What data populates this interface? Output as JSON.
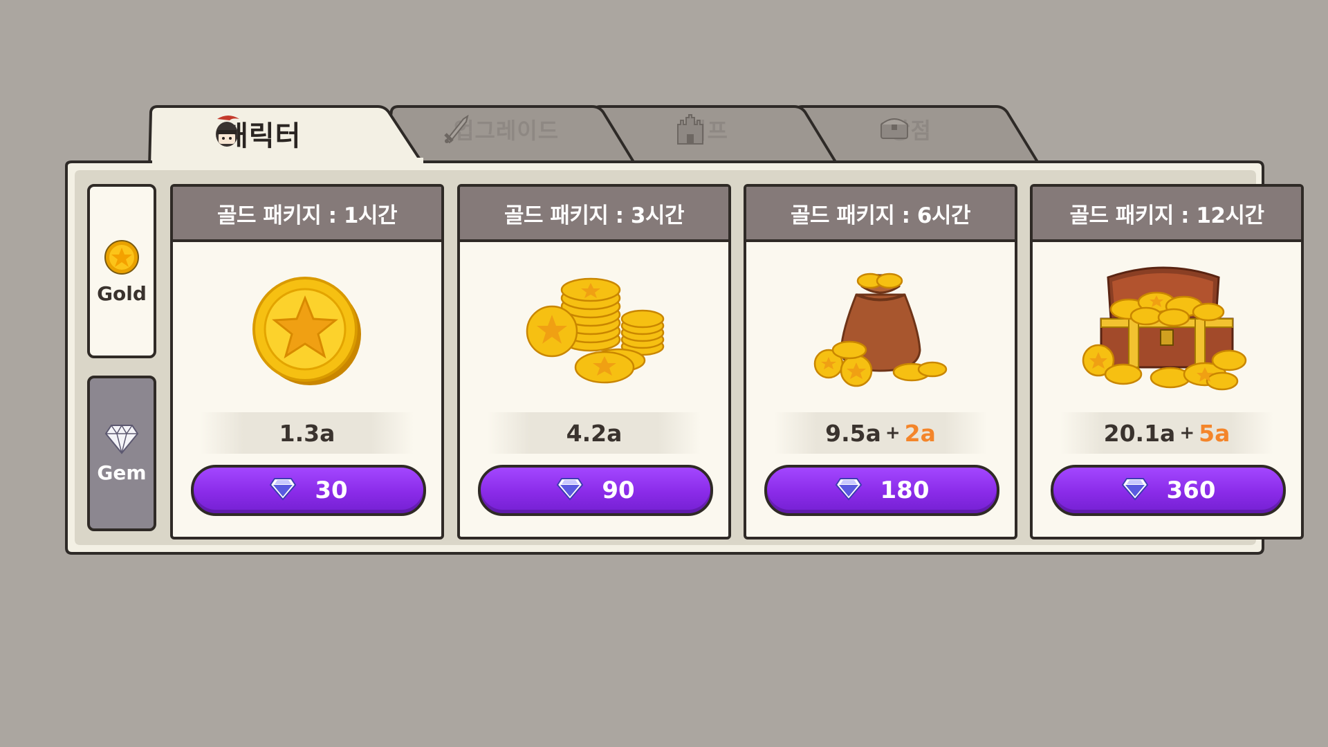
{
  "tabs": [
    {
      "label": "캐릭터",
      "icon": "knight-helmet-icon",
      "active": true
    },
    {
      "label": "업그레이드",
      "icon": "sword-icon",
      "active": false
    },
    {
      "label": "버프",
      "icon": "castle-icon",
      "active": false
    },
    {
      "label": "상점",
      "icon": "chest-icon",
      "active": false
    }
  ],
  "side": {
    "gold": {
      "label": "Gold",
      "icon": "gold-coin-icon",
      "selected": true
    },
    "gem": {
      "label": "Gem",
      "icon": "diamond-icon",
      "selected": false
    }
  },
  "packages": [
    {
      "title": "골드 패키지 : 1시간",
      "art": "single-coin",
      "amount": "1.3a",
      "bonus": "",
      "price": "30"
    },
    {
      "title": "골드 패키지 : 3시간",
      "art": "coin-stacks",
      "amount": "4.2a",
      "bonus": "",
      "price": "90"
    },
    {
      "title": "골드 패키지 : 6시간",
      "art": "coin-bag",
      "amount": "9.5a",
      "bonus": "2a",
      "price": "180"
    },
    {
      "title": "골드 패키지 : 12시간",
      "art": "treasure-chest",
      "amount": "20.1a",
      "bonus": "5a",
      "price": "360"
    }
  ],
  "colors": {
    "background": "#aba6a0",
    "panel": "#f3f0e4",
    "card_header": "#857a79",
    "button": "#8a2be8",
    "bonus": "#f4852a"
  }
}
